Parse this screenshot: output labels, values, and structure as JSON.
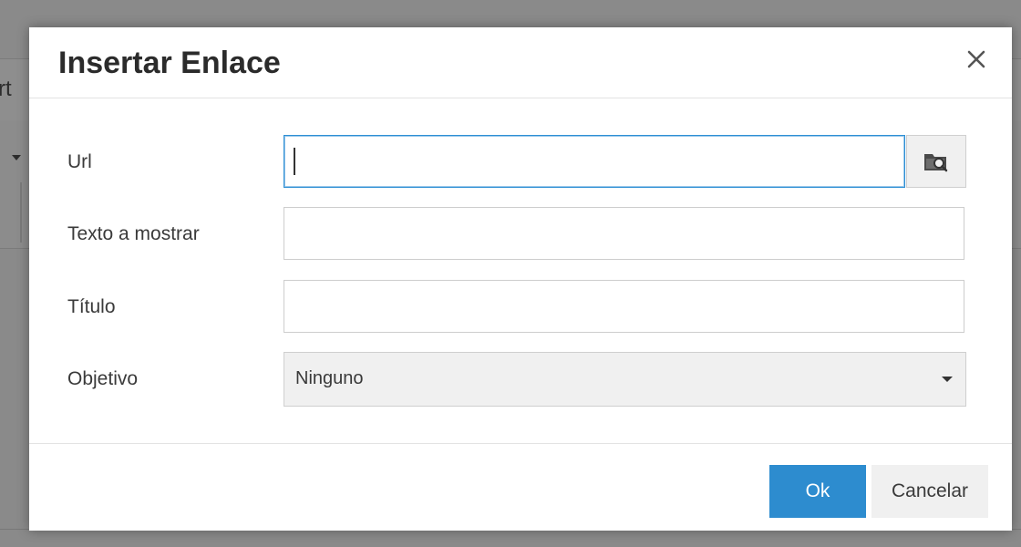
{
  "background": {
    "menu_text_fragment": "rt"
  },
  "dialog": {
    "title": "Insertar Enlace",
    "close_icon": "close-icon"
  },
  "form": {
    "url": {
      "label": "Url",
      "value": "",
      "browse_icon": "folder-search-icon"
    },
    "display_text": {
      "label": "Texto a mostrar",
      "value": ""
    },
    "title": {
      "label": "Título",
      "value": ""
    },
    "target": {
      "label": "Objetivo",
      "selected": "Ninguno"
    }
  },
  "footer": {
    "ok_label": "Ok",
    "cancel_label": "Cancelar"
  },
  "colors": {
    "primary": "#2d8ccf",
    "focus_border": "#2d8fd4",
    "secondary_bg": "#f0f0f0"
  }
}
